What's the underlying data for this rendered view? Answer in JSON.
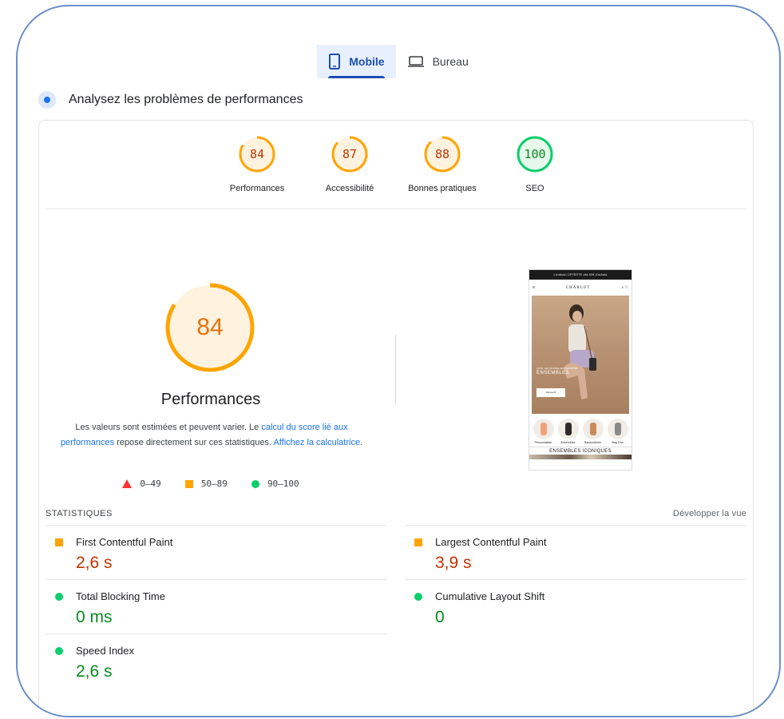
{
  "tabs": {
    "mobile": "Mobile",
    "desktop": "Bureau",
    "active": "mobile"
  },
  "section": {
    "title": "Analysez les problèmes de performances"
  },
  "categories": [
    {
      "label": "Performances",
      "score": "84",
      "color": "#ffa400",
      "text_color": "#c33300",
      "bg": "#fff3e0"
    },
    {
      "label": "Accessibilité",
      "score": "87",
      "color": "#ffa400",
      "text_color": "#c33300",
      "bg": "#fff3e0"
    },
    {
      "label": "Bonnes pratiques",
      "score": "88",
      "color": "#ffa400",
      "text_color": "#c33300",
      "bg": "#fff3e0"
    },
    {
      "label": "SEO",
      "score": "100",
      "color": "#0cce6b",
      "text_color": "#0a8a1f",
      "bg": "#e6f7ec"
    }
  ],
  "performance": {
    "score": "84",
    "score_fraction": 0.84,
    "title": "Performances",
    "desc_1": "Les valeurs sont estimées et peuvent varier. Le ",
    "desc_link_1": "calcul du score lié aux performances",
    "desc_2": " repose directement sur ces statistiques. ",
    "desc_link_2": "Affichez la calculatrice",
    "desc_3": "."
  },
  "legend": {
    "fail": "0–49",
    "average": "50–89",
    "pass": "90–100"
  },
  "thumbnail": {
    "banner": "Livraison OFFERTE dès 69€ d'achats",
    "brand": "CHARLOT",
    "brand_sub": "PARIS",
    "hero_sub": "L'ÉTÉ, LES NOUVELLES FAVORITES",
    "hero_title": "ENSEMBLES",
    "hero_button": "Découvrir",
    "cats": [
      "Personnaliser",
      "Ensembles",
      "Bandoulières",
      "Bag Cha"
    ],
    "section_title": "ENSEMBLES ICONIQUES"
  },
  "statistics": {
    "heading": "STATISTIQUES",
    "expand": "Développer la vue",
    "left": [
      {
        "name": "First Contentful Paint",
        "value": "2,6 s",
        "status": "average"
      },
      {
        "name": "Total Blocking Time",
        "value": "0 ms",
        "status": "pass"
      },
      {
        "name": "Speed Index",
        "value": "2,6 s",
        "status": "pass"
      }
    ],
    "right": [
      {
        "name": "Largest Contentful Paint",
        "value": "3,9 s",
        "status": "average"
      },
      {
        "name": "Cumulative Layout Shift",
        "value": "0",
        "status": "pass"
      }
    ]
  },
  "colors": {
    "accent": "#1a73e8",
    "average": "#ffa400",
    "pass": "#0cce6b",
    "fail": "#ff3333"
  }
}
